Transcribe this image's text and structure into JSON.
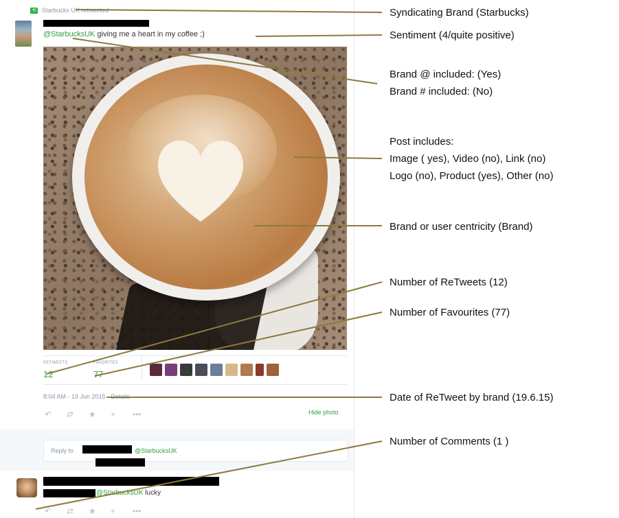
{
  "tweet": {
    "retweeted_by": "Starbucks UK retweeted",
    "text_mention": "@StarbucksUK",
    "text_body": " giving me a heart in my coffee ;)",
    "stats": {
      "retweets_label": "RETWEETS",
      "retweets_value": "12",
      "favorites_label": "FAVORITES",
      "favorites_value": "77"
    },
    "date_line": "8:04 AM - 19 Jun 2015 · Details",
    "hide_photo": "Hide photo",
    "reply_prefix": "Reply to",
    "reply_mention": "@StarbucksUK",
    "comment_mention": "@StarbucksUK",
    "comment_text": " lucky"
  },
  "icons": {
    "reply": "reply-icon",
    "retweet": "retweet-icon",
    "favorite": "star-icon",
    "follow": "add-user-icon",
    "more": "more-icon"
  },
  "colors": {
    "link_green": "#2e9f3b",
    "muted": "#8899a6",
    "annotation_line": "#8c7a3c"
  },
  "annotations": {
    "syndicating": "Syndicating Brand (Starbucks)",
    "sentiment": "Sentiment (4/quite positive)",
    "brand_at": "Brand @ included: (Yes)",
    "brand_hash": "Brand # included: (No)",
    "post_includes": "Post includes:",
    "media_line": "Image ( yes), Video (no), Link (no)",
    "logo_line": "Logo (no), Product (yes), Other (no)",
    "centricity": "Brand or user centricity (Brand)",
    "retweets": "Number of ReTweets (12)",
    "favourites": "Number of Favourites (77)",
    "date": "Date of ReTweet by brand (19.6.15)",
    "comments": "Number of Comments (1 )"
  }
}
